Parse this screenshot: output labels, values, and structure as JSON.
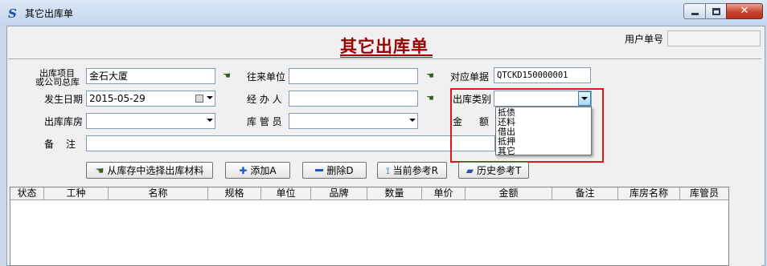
{
  "window": {
    "title": "其它出库单",
    "app_icon_glyph": "S",
    "minimize_glyph": "minimize-icon",
    "maximize_glyph": "maximize-icon",
    "close_glyph": "✕"
  },
  "header": {
    "form_title": "其它出库单",
    "user_no_label": "用户单号",
    "user_no_value": ""
  },
  "fields": {
    "project_label_line1": "出库项目",
    "project_label_line2": "或公司总库",
    "project_value": "金石大厦",
    "partner_label": "往来单位",
    "partner_value": "",
    "ref_doc_label": "对应单据",
    "ref_doc_value": "QTCKD150000001",
    "date_label": "发生日期",
    "date_value": "2015-05-29",
    "handler_label": "经 办 人",
    "handler_value": "",
    "category_label": "出库类别",
    "category_value": "",
    "warehouse_label": "出库库房",
    "warehouse_value": "",
    "keeper_label": "库 管 员",
    "keeper_value": "",
    "amount_label_1": "金",
    "amount_label_2": "额",
    "remark_label_1": "备",
    "remark_label_2": "注",
    "remark_value": ""
  },
  "category_options": [
    "抵债",
    "还料",
    "借出",
    "抵押",
    "其它"
  ],
  "buttons": {
    "select_from_stock": "从库存中选择出库材料",
    "add": "添加A",
    "delete": "删除D",
    "current_ref": "当前参考R",
    "history_ref": "历史参考T"
  },
  "table": {
    "columns": [
      "状态",
      "工种",
      "名称",
      "规格",
      "单位",
      "品牌",
      "数量",
      "单价",
      "金额",
      "备注",
      "库房名称",
      "库管员"
    ],
    "rows": []
  },
  "colors": {
    "title_red": "#9a0000",
    "highlight_red": "#e0141c",
    "window_bg": "#f0f0f0",
    "accent_blue": "#1c55c8"
  }
}
